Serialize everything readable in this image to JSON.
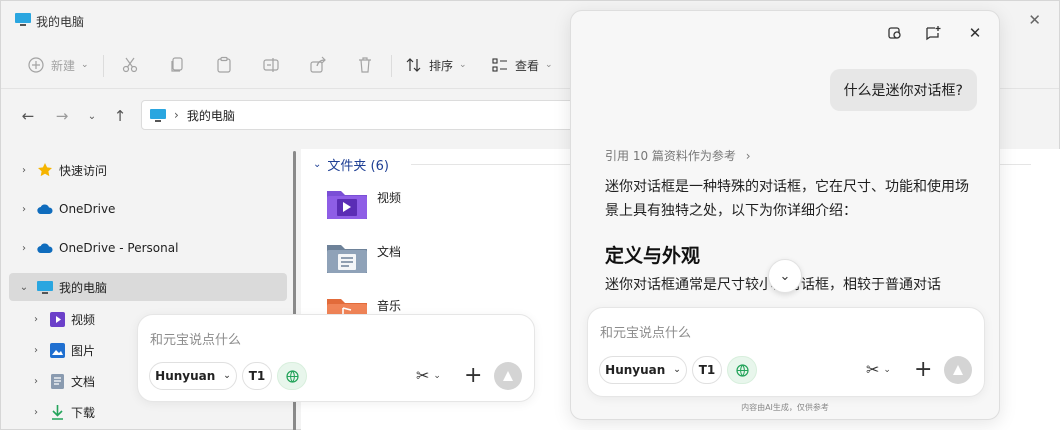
{
  "window": {
    "title": "我的电脑"
  },
  "toolbar": {
    "new_label": "新建",
    "sort_label": "排序",
    "view_label": "查看"
  },
  "address": {
    "location": "我的电脑"
  },
  "sidebar": {
    "items": [
      {
        "label": "快速访问"
      },
      {
        "label": "OneDrive"
      },
      {
        "label": "OneDrive - Personal"
      },
      {
        "label": "我的电脑"
      },
      {
        "label": "视频"
      },
      {
        "label": "图片"
      },
      {
        "label": "文档"
      },
      {
        "label": "下载"
      }
    ]
  },
  "content": {
    "group_header": "文件夹 (6)",
    "folders": [
      {
        "name": "视频"
      },
      {
        "name": "文档"
      },
      {
        "name": "音乐"
      }
    ]
  },
  "left_input": {
    "placeholder": "和元宝说点什么",
    "model": "Hunyuan",
    "t1": "T1"
  },
  "panel": {
    "user_question": "什么是迷你对话框?",
    "refs": "引用 10 篇资料作为参考",
    "answer_intro": "迷你对话框是一种特殊的对话框，它在尺寸、功能和使用场景上具有独特之处，以下为你详细介绍：",
    "section_heading": "定义与外观",
    "section_text": "迷你对话框通常是尺寸较小的对话框，相较于普通对话",
    "input_placeholder": "和元宝说点什么",
    "model": "Hunyuan",
    "t1": "T1",
    "disclaimer": "内容由AI生成，仅供参考"
  },
  "colors": {
    "accent_blue": "#1e3f94",
    "selection_gray": "#dadada",
    "green_pill": "#e8f6ec"
  }
}
